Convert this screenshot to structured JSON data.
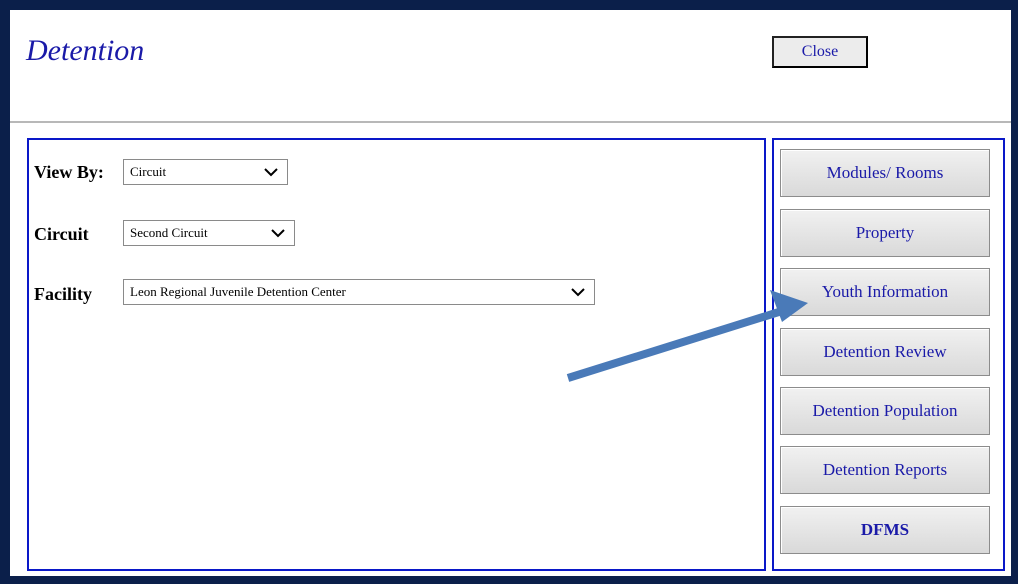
{
  "window": {
    "title": "Detention",
    "close_label": "Close"
  },
  "filters": {
    "view_by": {
      "label": "View By:",
      "value": "Circuit"
    },
    "circuit": {
      "label": "Circuit",
      "value": "Second Circuit"
    },
    "facility": {
      "label": "Facility",
      "value": "Leon Regional Juvenile Detention Center"
    }
  },
  "nav": {
    "buttons": [
      {
        "label": "Modules/ Rooms"
      },
      {
        "label": "Property"
      },
      {
        "label": "Youth Information"
      },
      {
        "label": "Detention Review"
      },
      {
        "label": "Detention Population"
      },
      {
        "label": "Detention Reports"
      },
      {
        "label": "DFMS"
      }
    ]
  },
  "colors": {
    "frame": "#0b1f4a",
    "panel_border": "#0a18c8",
    "link_text": "#1a1aa8",
    "annotation_arrow": "#4a7ab8"
  },
  "icons": {
    "dropdown": "chevron-down-icon",
    "annotation": "arrow-icon"
  }
}
